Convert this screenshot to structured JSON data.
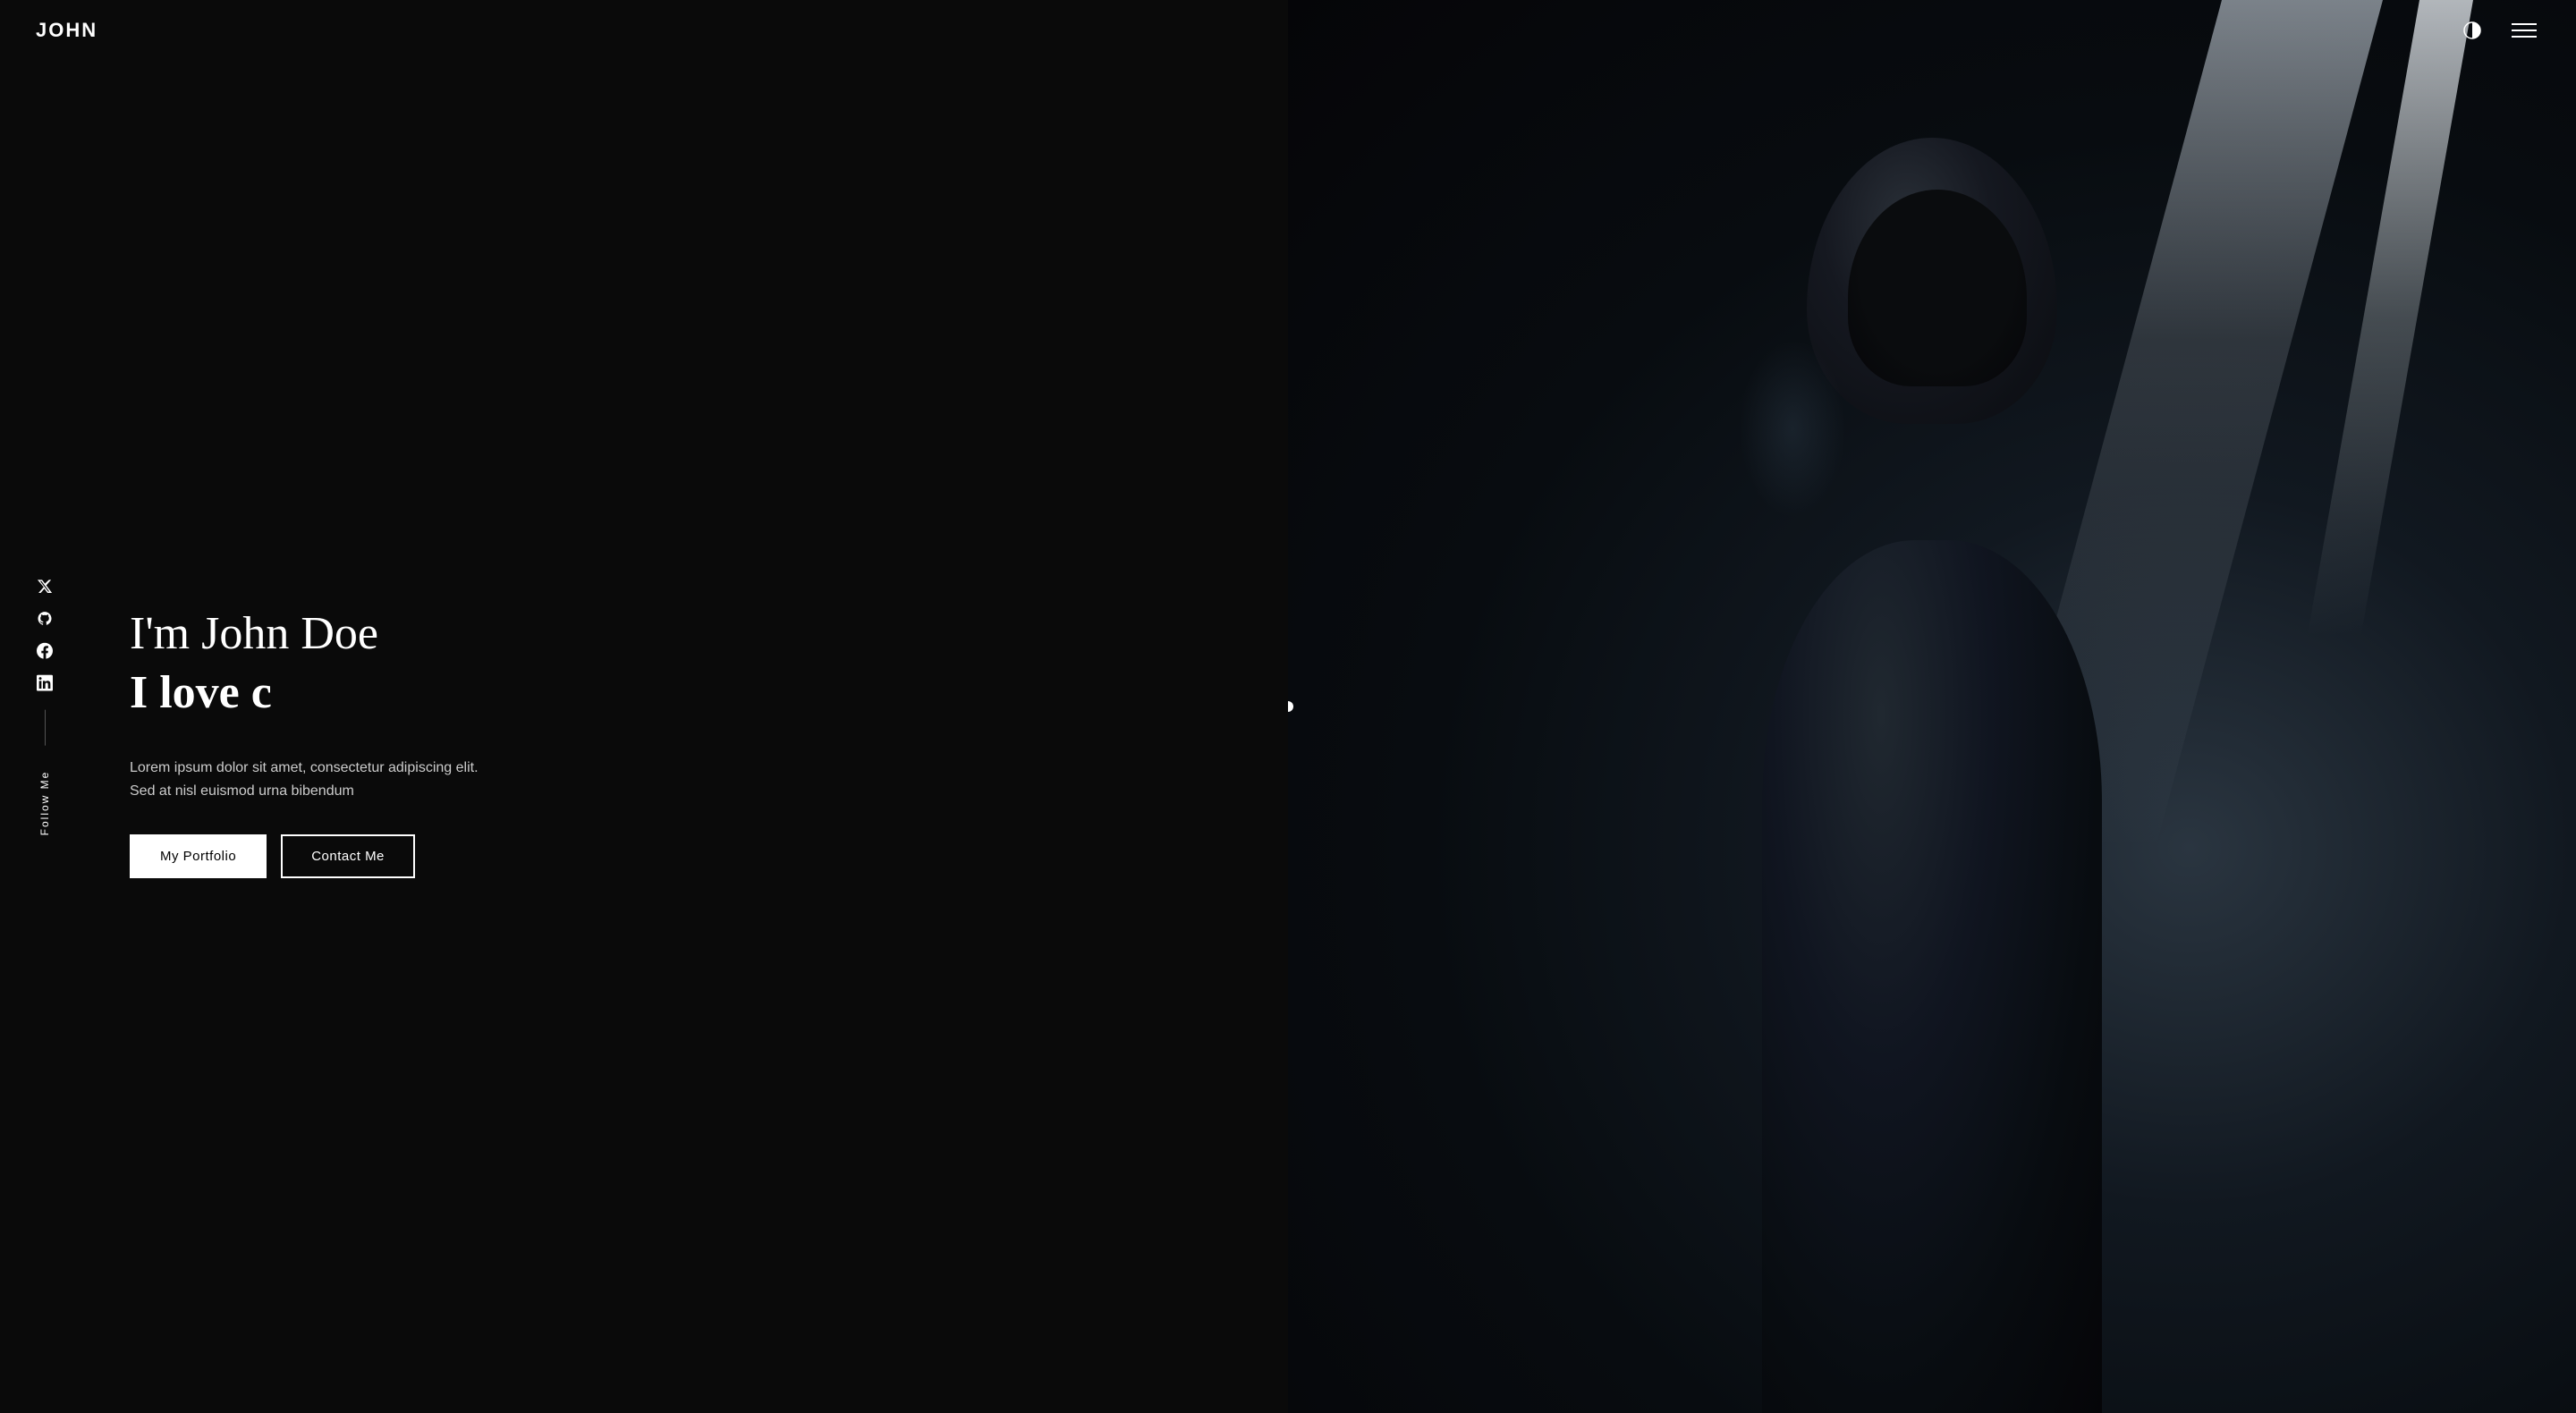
{
  "header": {
    "logo": "JOHN",
    "theme_icon": "half-circle",
    "menu_icon": "hamburger"
  },
  "sidebar": {
    "social_icons": [
      {
        "name": "twitter",
        "symbol": "𝕏"
      },
      {
        "name": "github",
        "symbol": "⊙"
      },
      {
        "name": "facebook",
        "symbol": "f"
      },
      {
        "name": "linkedin",
        "symbol": "in"
      }
    ],
    "follow_label": "Follow Me"
  },
  "hero": {
    "name_line": "I'm John Doe",
    "tagline": "I love c",
    "description": "Lorem ipsum dolor sit amet, consectetur adipiscing elit. Sed at nisl euismod urna bibendum",
    "btn_portfolio": "My Portfolio",
    "btn_contact": "Contact Me"
  },
  "colors": {
    "background": "#0a0a0a",
    "text_primary": "#ffffff",
    "text_secondary": "#cccccc",
    "accent": "#ffffff"
  }
}
